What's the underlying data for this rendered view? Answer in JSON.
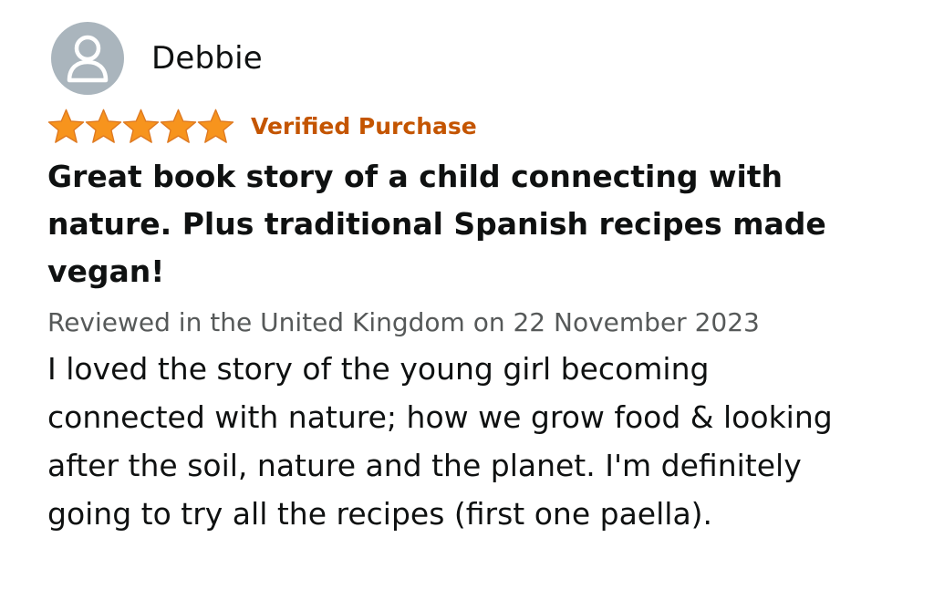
{
  "review": {
    "reviewer_name": "Debbie",
    "rating": 5,
    "rating_max": 5,
    "verified_label": "Verified Purchase",
    "title": "Great book story of a child connecting with nature. Plus traditional Spanish recipes made vegan!",
    "meta": "Reviewed in the United Kingdom on 22 November 2023",
    "body": "I loved the story of the young girl becoming connected with nature; how we grow food & looking after the soil, nature and the planet. I'm definitely going to try all the recipes (first one paella)."
  },
  "colors": {
    "star": "#f7941d",
    "star_outline": "#de7921",
    "verified": "#c45500",
    "avatar_bg": "#aab5bd",
    "meta_text": "#565959"
  },
  "icons": {
    "avatar": "user-silhouette-icon",
    "star": "star-icon"
  }
}
